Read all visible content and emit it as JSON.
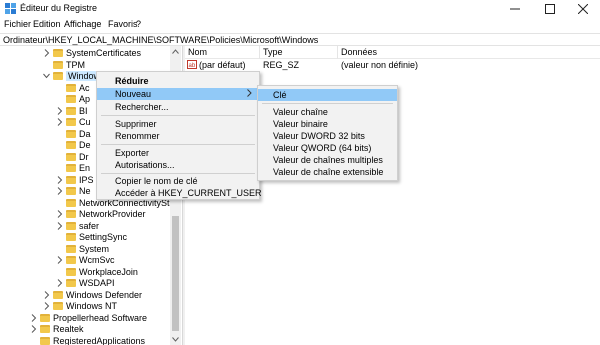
{
  "window": {
    "title": "Éditeur du Registre",
    "minimize_icon": "minimize-icon",
    "maximize_icon": "maximize-icon",
    "close_icon": "close-icon"
  },
  "menubar": {
    "items": [
      "Fichier",
      "Edition",
      "Affichage",
      "Favoris",
      "?"
    ]
  },
  "address": {
    "path": "Ordinateur\\HKEY_LOCAL_MACHINE\\SOFTWARE\\Policies\\Microsoft\\Windows"
  },
  "tree": {
    "items": [
      {
        "label": "SystemCertificates",
        "expandable": true
      },
      {
        "label": "TPM",
        "expandable": false
      },
      {
        "label": "Windows",
        "expandable": true,
        "expanded": true
      },
      {
        "label": "Ac",
        "expandable": false
      },
      {
        "label": "Ap",
        "expandable": false
      },
      {
        "label": "BI",
        "expandable": true
      },
      {
        "label": "Cu",
        "expandable": true
      },
      {
        "label": "Da",
        "expandable": false
      },
      {
        "label": "De",
        "expandable": false
      },
      {
        "label": "Dr",
        "expandable": false
      },
      {
        "label": "En",
        "expandable": false
      },
      {
        "label": "IPS",
        "expandable": true
      },
      {
        "label": "Ne",
        "expandable": true
      },
      {
        "label": "NetworkConnectivitySta",
        "expandable": false
      },
      {
        "label": "NetworkProvider",
        "expandable": true
      },
      {
        "label": "safer",
        "expandable": true
      },
      {
        "label": "SettingSync",
        "expandable": false
      },
      {
        "label": "System",
        "expandable": false
      },
      {
        "label": "WcmSvc",
        "expandable": true
      },
      {
        "label": "WorkplaceJoin",
        "expandable": false
      },
      {
        "label": "WSDAPI",
        "expandable": true
      },
      {
        "label": "Windows Defender",
        "expandable": true
      },
      {
        "label": "Windows NT",
        "expandable": true
      },
      {
        "label": "Propellerhead Software",
        "expandable": true
      },
      {
        "label": "Realtek",
        "expandable": true
      },
      {
        "label": "RegisteredApplications",
        "expandable": false
      }
    ]
  },
  "values_pane": {
    "columns": [
      "Nom",
      "Type",
      "Données"
    ],
    "rows": [
      {
        "name": "(par défaut)",
        "type": "REG_SZ",
        "data": "(valeur non définie)",
        "icon": "string-value-icon"
      }
    ]
  },
  "context_menu": {
    "items": [
      {
        "label": "Réduire",
        "bold": true
      },
      {
        "label": "Nouveau",
        "submenu": true,
        "highlighted": true
      },
      {
        "label": "Rechercher..."
      },
      {
        "label": "Supprimer"
      },
      {
        "label": "Renommer"
      },
      {
        "label": "Exporter"
      },
      {
        "label": "Autorisations..."
      },
      {
        "label": "Copier le nom de clé"
      },
      {
        "label": "Accéder à HKEY_CURRENT_USER"
      }
    ]
  },
  "submenu": {
    "items": [
      {
        "label": "Clé",
        "highlighted": true
      },
      {
        "label": "Valeur chaîne"
      },
      {
        "label": "Valeur binaire"
      },
      {
        "label": "Valeur DWORD 32 bits"
      },
      {
        "label": "Valeur QWORD (64 bits)"
      },
      {
        "label": "Valeur de chaînes multiples"
      },
      {
        "label": "Valeur de chaîne extensible"
      }
    ]
  },
  "colors": {
    "highlight": "#91c9f7",
    "menu_bg": "#f2f2f2",
    "folder": "#f2c84b"
  }
}
